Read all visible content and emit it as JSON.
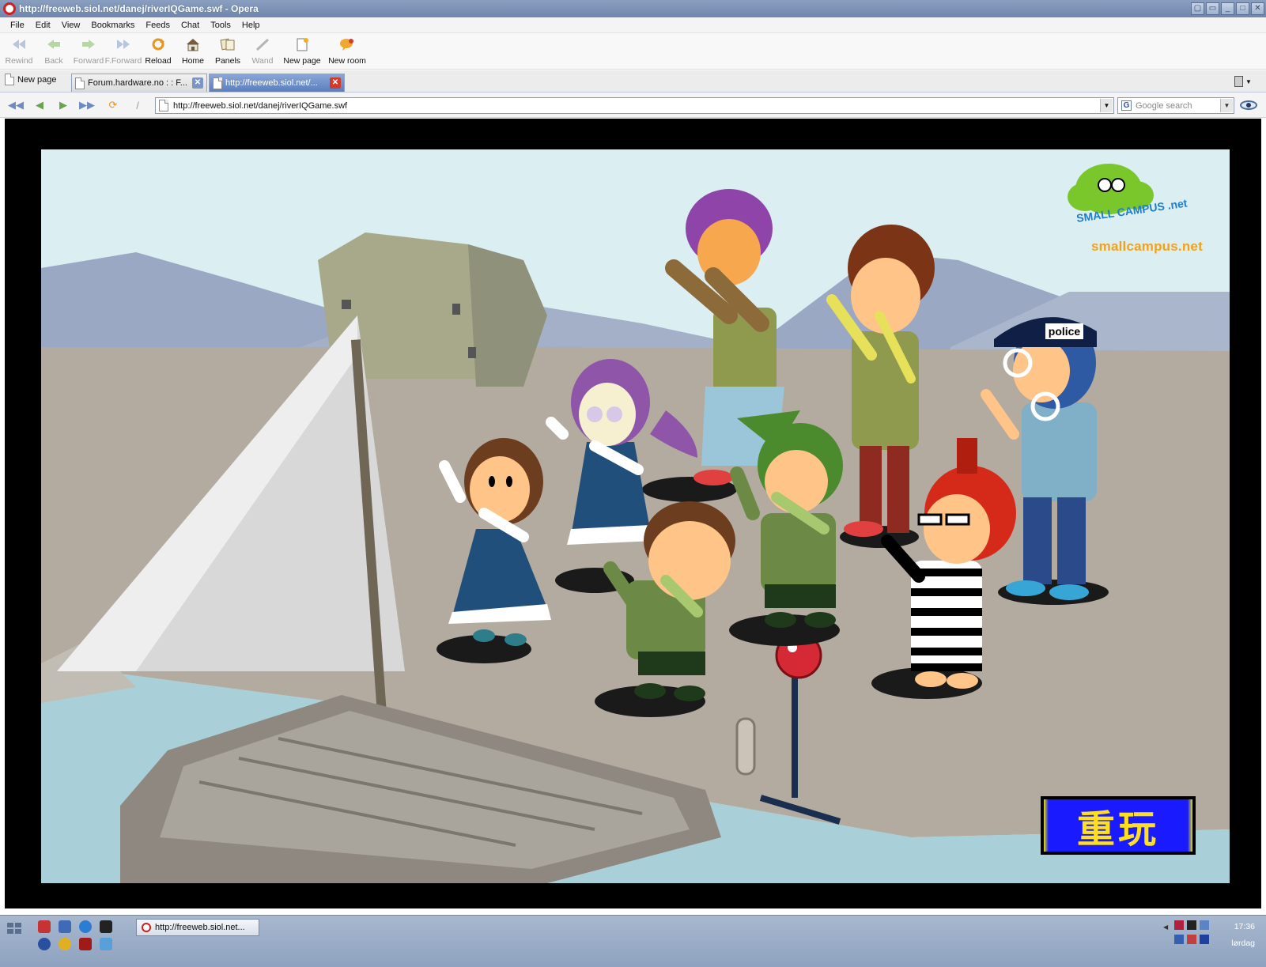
{
  "window": {
    "title": "http://freeweb.siol.net/danej/riverIQGame.swf - Opera",
    "controls": [
      "restore-alt",
      "minimize-alt",
      "minimize",
      "maximize",
      "close"
    ]
  },
  "menu": [
    "File",
    "Edit",
    "View",
    "Bookmarks",
    "Feeds",
    "Chat",
    "Tools",
    "Help"
  ],
  "toolbar": [
    {
      "label": "Rewind",
      "icon": "rewind-icon",
      "enabled": false
    },
    {
      "label": "Back",
      "icon": "back-icon",
      "enabled": false
    },
    {
      "label": "Forward",
      "icon": "forward-icon",
      "enabled": false
    },
    {
      "label": "F.Forward",
      "icon": "fast-forward-icon",
      "enabled": false
    },
    {
      "label": "Reload",
      "icon": "reload-icon",
      "enabled": true
    },
    {
      "label": "Home",
      "icon": "home-icon",
      "enabled": true
    },
    {
      "label": "Panels",
      "icon": "panels-icon",
      "enabled": true
    },
    {
      "label": "Wand",
      "icon": "wand-icon",
      "enabled": false
    },
    {
      "label": "New page",
      "icon": "new-page-icon",
      "enabled": true
    },
    {
      "label": "New room",
      "icon": "new-room-icon",
      "enabled": true
    }
  ],
  "tabs": {
    "new_page_label": "New page",
    "items": [
      {
        "title": "Forum.hardware.no : : F...",
        "active": false
      },
      {
        "title": "http://freeweb.siol.net/...",
        "active": true
      }
    ]
  },
  "address": {
    "url": "http://freeweb.siol.net/danej/riverIQGame.swf",
    "search_placeholder": "Google search"
  },
  "game": {
    "logo_brand": "SMALL CAMPUS .net",
    "logo_caption": "smallcampus.net",
    "police_cap_label": "police",
    "replay_button": "重玩",
    "colors": {
      "sky": "#dbeef2",
      "ground": "#b3aba0",
      "water": "#a9cfd9",
      "replay_bg": "#1a1aff",
      "replay_text": "#ffe01a",
      "logo_text": "#f2a21a"
    }
  },
  "taskbar": {
    "task_title": "http://freeweb.siol.net...",
    "time": "17:36",
    "day": "lørdag"
  }
}
